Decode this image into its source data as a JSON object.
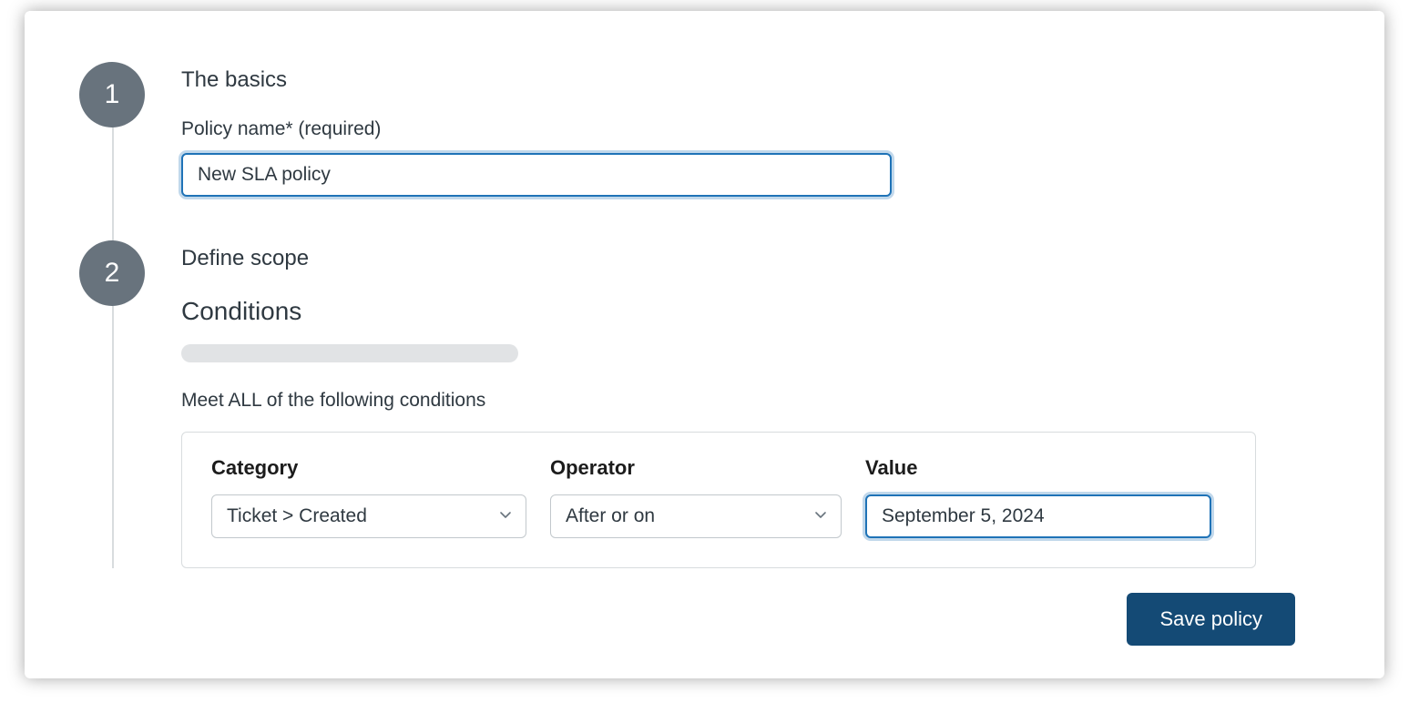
{
  "step1": {
    "number": "1",
    "title": "The basics",
    "policy_name_label": "Policy name* (required)",
    "policy_name_value": "New SLA policy"
  },
  "step2": {
    "number": "2",
    "title": "Define scope",
    "conditions_heading": "Conditions",
    "conditions_intro": "Meet ALL of the following conditions",
    "columns": {
      "category_label": "Category",
      "operator_label": "Operator",
      "value_label": "Value"
    },
    "row": {
      "category": "Ticket > Created",
      "operator": "After or on",
      "value": "September 5, 2024"
    }
  },
  "actions": {
    "save_label": "Save policy"
  }
}
